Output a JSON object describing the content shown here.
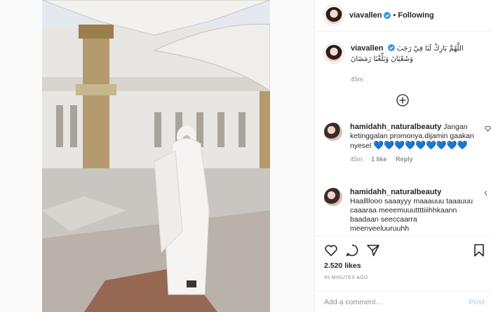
{
  "post": {
    "photo_alt": "",
    "author": {
      "username": "viavallen",
      "verified_icon": "verified-badge-icon",
      "separator": "•",
      "follow_state": "Following"
    },
    "caption": {
      "username": "viavallen",
      "text": "اللَّهُمَّ بَارِكْ لَنَا فِيْ رَجَبَ وَشَعْبَانَ وَبَلِّغْنَا رَمَضَانَ",
      "time": "45m"
    },
    "load_more_icon": "plus-circle-icon",
    "comments": [
      {
        "username": "hamidahh_naturalbeauty",
        "text": "Jangan ketinggalan promonya.dijamin gaakan nyesel",
        "hearts": "💙💙💙💙💙💙💙💙💙",
        "time": "45m",
        "likes": "1 like",
        "reply": "Reply"
      },
      {
        "username": "hamidahh_naturalbeauty",
        "text": "Haallllooo saaayyy maaauuu taaauuu caaaraa meeemuuuttttiiihhkaann baadaan seeccaarra meenyeeluuruuhh"
      }
    ],
    "actions": {
      "like_icon": "heart-icon",
      "comment_icon": "comment-icon",
      "share_icon": "share-icon",
      "save_icon": "bookmark-icon"
    },
    "likes_text": "2.520 likes",
    "ago_text": "45 MINUTES AGO",
    "add_comment": {
      "placeholder": "Add a comment…",
      "post_label": "Post"
    }
  },
  "colors": {
    "link_blue": "#b3dbff",
    "verified_blue": "#3897f0",
    "muted": "#8e8e8e"
  }
}
